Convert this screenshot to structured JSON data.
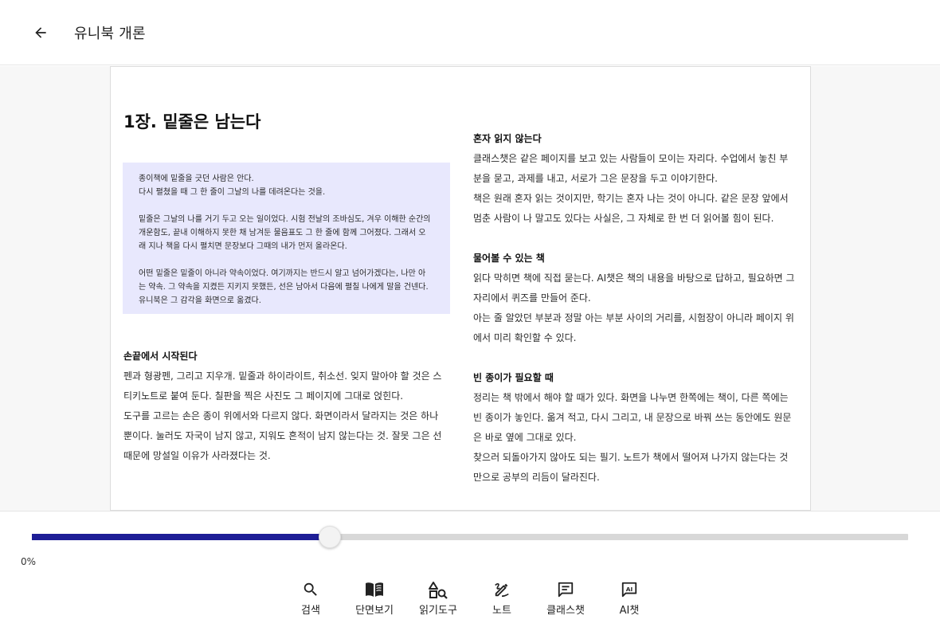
{
  "header": {
    "back_icon": "arrow-left-icon",
    "title": "유니북 개론"
  },
  "page": {
    "chapter_title": "1장. 밑줄은 남는다",
    "quote": {
      "paragraphs": [
        [
          "종이책에 밑줄을 긋던 사람은 안다.",
          "다시 펼쳤을 때 그 한 줄이 그날의 나를 데려온다는 것을."
        ],
        [
          "밑줄은 그날의 나를 거기 두고 오는 일이었다. 시험 전날의 조바심도, 겨우 이해한 순간의",
          "개운함도, 끝내 이해하지 못한 채 남겨둔 물음표도 그 한 줄에 함께 그어졌다. 그래서 오",
          "래 지나 책을 다시 펼치면 문장보다 그때의 내가 먼저 올라온다."
        ],
        [
          "어떤 밑줄은 밑줄이 아니라 약속이었다. 여기까지는 반드시 알고 넘어가겠다는, 나만 아",
          "는 약속. 그 약속을 지켰든 지키지 못했든, 선은 남아서 다음에 펼칠 나에게 말을 건넨다.",
          "유니북은 그 감각을 화면으로 옮겼다."
        ]
      ]
    },
    "left_section": {
      "heading": "손끝에서 시작된다",
      "lines": [
        "펜과 형광펜, 그리고 지우개. 밑줄과 하이라이트, 취소선. 잊지 말아야 할 것은 스",
        "티키노트로 붙여 둔다. 칠판을 찍은 사진도 그 페이지에 그대로 얹힌다.",
        "도구를 고르는 손은 종이 위에서와 다르지 않다. 화면이라서 달라지는 것은 하나",
        "뿐이다. 눌러도 자국이 남지 않고, 지워도 흔적이 남지 않는다는 것. 잘못 그은 선",
        "때문에 망설일 이유가 사라졌다는 것."
      ]
    },
    "right_sections": [
      {
        "heading": "혼자 읽지 않는다",
        "lines": [
          "클래스챗은 같은 페이지를 보고 있는 사람들이 모이는 자리다. 수업에서 놓친 부",
          "분을 묻고, 과제를 내고, 서로가 그은 문장을 두고 이야기한다.",
          "책은 원래 혼자 읽는 것이지만, 학기는 혼자 나는 것이 아니다. 같은 문장 앞에서",
          "멈춘 사람이 나 말고도 있다는 사실은, 그 자체로 한 번 더 읽어볼 힘이 된다."
        ]
      },
      {
        "heading": "물어볼 수 있는 책",
        "lines": [
          "읽다 막히면 책에 직접 묻는다. AI챗은 책의 내용을 바탕으로 답하고, 필요하면 그",
          "자리에서 퀴즈를 만들어 준다.",
          "아는 줄 알았던 부분과 정말 아는 부분 사이의 거리를, 시험장이 아니라 페이지 위",
          "에서 미리 확인할 수 있다."
        ]
      },
      {
        "heading": "빈 종이가 필요할 때",
        "lines": [
          "정리는 책 밖에서 해야 할 때가 있다. 화면을 나누면 한쪽에는 책이, 다른 쪽에는",
          "빈 종이가 놓인다. 옮겨 적고, 다시 그리고, 내 문장으로 바꿔 쓰는 동안에도 원문",
          "은 바로 옆에 그대로 있다.",
          "찾으러 되돌아가지 않아도 되는 필기. 노트가 책에서 떨어져 나가지 않는다는 것",
          "만으로 공부의 리듬이 달라진다."
        ]
      }
    ]
  },
  "progress": {
    "label": "0%",
    "slider_fraction": 0.34,
    "fill_color": "#1e1e96",
    "track_color": "#d8d8d8"
  },
  "toolbar": {
    "items": [
      {
        "label": "검색",
        "icon": "search-icon"
      },
      {
        "label": "단면보기",
        "icon": "book-open-icon"
      },
      {
        "label": "읽기도구",
        "icon": "reading-tools-icon"
      },
      {
        "label": "노트",
        "icon": "pen-icon"
      },
      {
        "label": "클래스챗",
        "icon": "chat-icon"
      },
      {
        "label": "AI챗",
        "icon": "ai-chat-icon"
      }
    ]
  },
  "colors": {
    "quote_background": "#e8e8fd",
    "reader_background": "#f7f7f7"
  }
}
